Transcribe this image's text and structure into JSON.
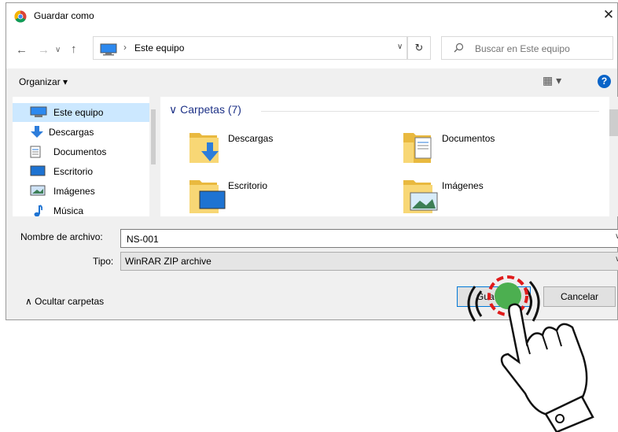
{
  "window": {
    "title": "Guardar como",
    "close_glyph": "✕"
  },
  "nav": {
    "back_glyph": "←",
    "forward_glyph": "→",
    "recent_glyph": "∨",
    "up_glyph": "↑",
    "address_separator": "›",
    "address": "Este equipo",
    "address_dropdown_glyph": "∨",
    "refresh_glyph": "↻"
  },
  "search": {
    "placeholder": "Buscar en Este equipo",
    "icon": "search-icon"
  },
  "toolbar": {
    "organize_label": "Organizar ▾",
    "view_glyph": "▦ ▾",
    "help_glyph": "?"
  },
  "sidebar": {
    "items": [
      {
        "label": "Este equipo",
        "icon": "computer-icon",
        "selected": true
      },
      {
        "label": "Descargas",
        "icon": "download-icon"
      },
      {
        "label": "Documentos",
        "icon": "document-icon"
      },
      {
        "label": "Escritorio",
        "icon": "desktop-icon"
      },
      {
        "label": "Imágenes",
        "icon": "pictures-icon"
      },
      {
        "label": "Música",
        "icon": "music-icon"
      }
    ]
  },
  "main": {
    "group_header": "∨ Carpetas (7)",
    "folders": [
      {
        "label": "Descargas",
        "overlay": "download"
      },
      {
        "label": "Documentos",
        "overlay": "document"
      },
      {
        "label": "Escritorio",
        "overlay": "desktop"
      },
      {
        "label": "Imágenes",
        "overlay": "pictures"
      }
    ]
  },
  "form": {
    "filename_label": "Nombre de archivo:",
    "filename_value": "NS-001",
    "type_label": "Tipo:",
    "type_value": "WinRAR ZIP archive",
    "dropdown_glyph": "∨"
  },
  "footer": {
    "toggle_folders": "∧  Ocultar carpetas",
    "save_label": "Gua",
    "cancel_label": "Cancelar"
  },
  "colors": {
    "accent": "#0078d7",
    "selection": "#cce8ff",
    "folder": "#f8d775",
    "header": "#1e3287",
    "click_green": "#4caf50",
    "click_red": "#e01b1b"
  }
}
